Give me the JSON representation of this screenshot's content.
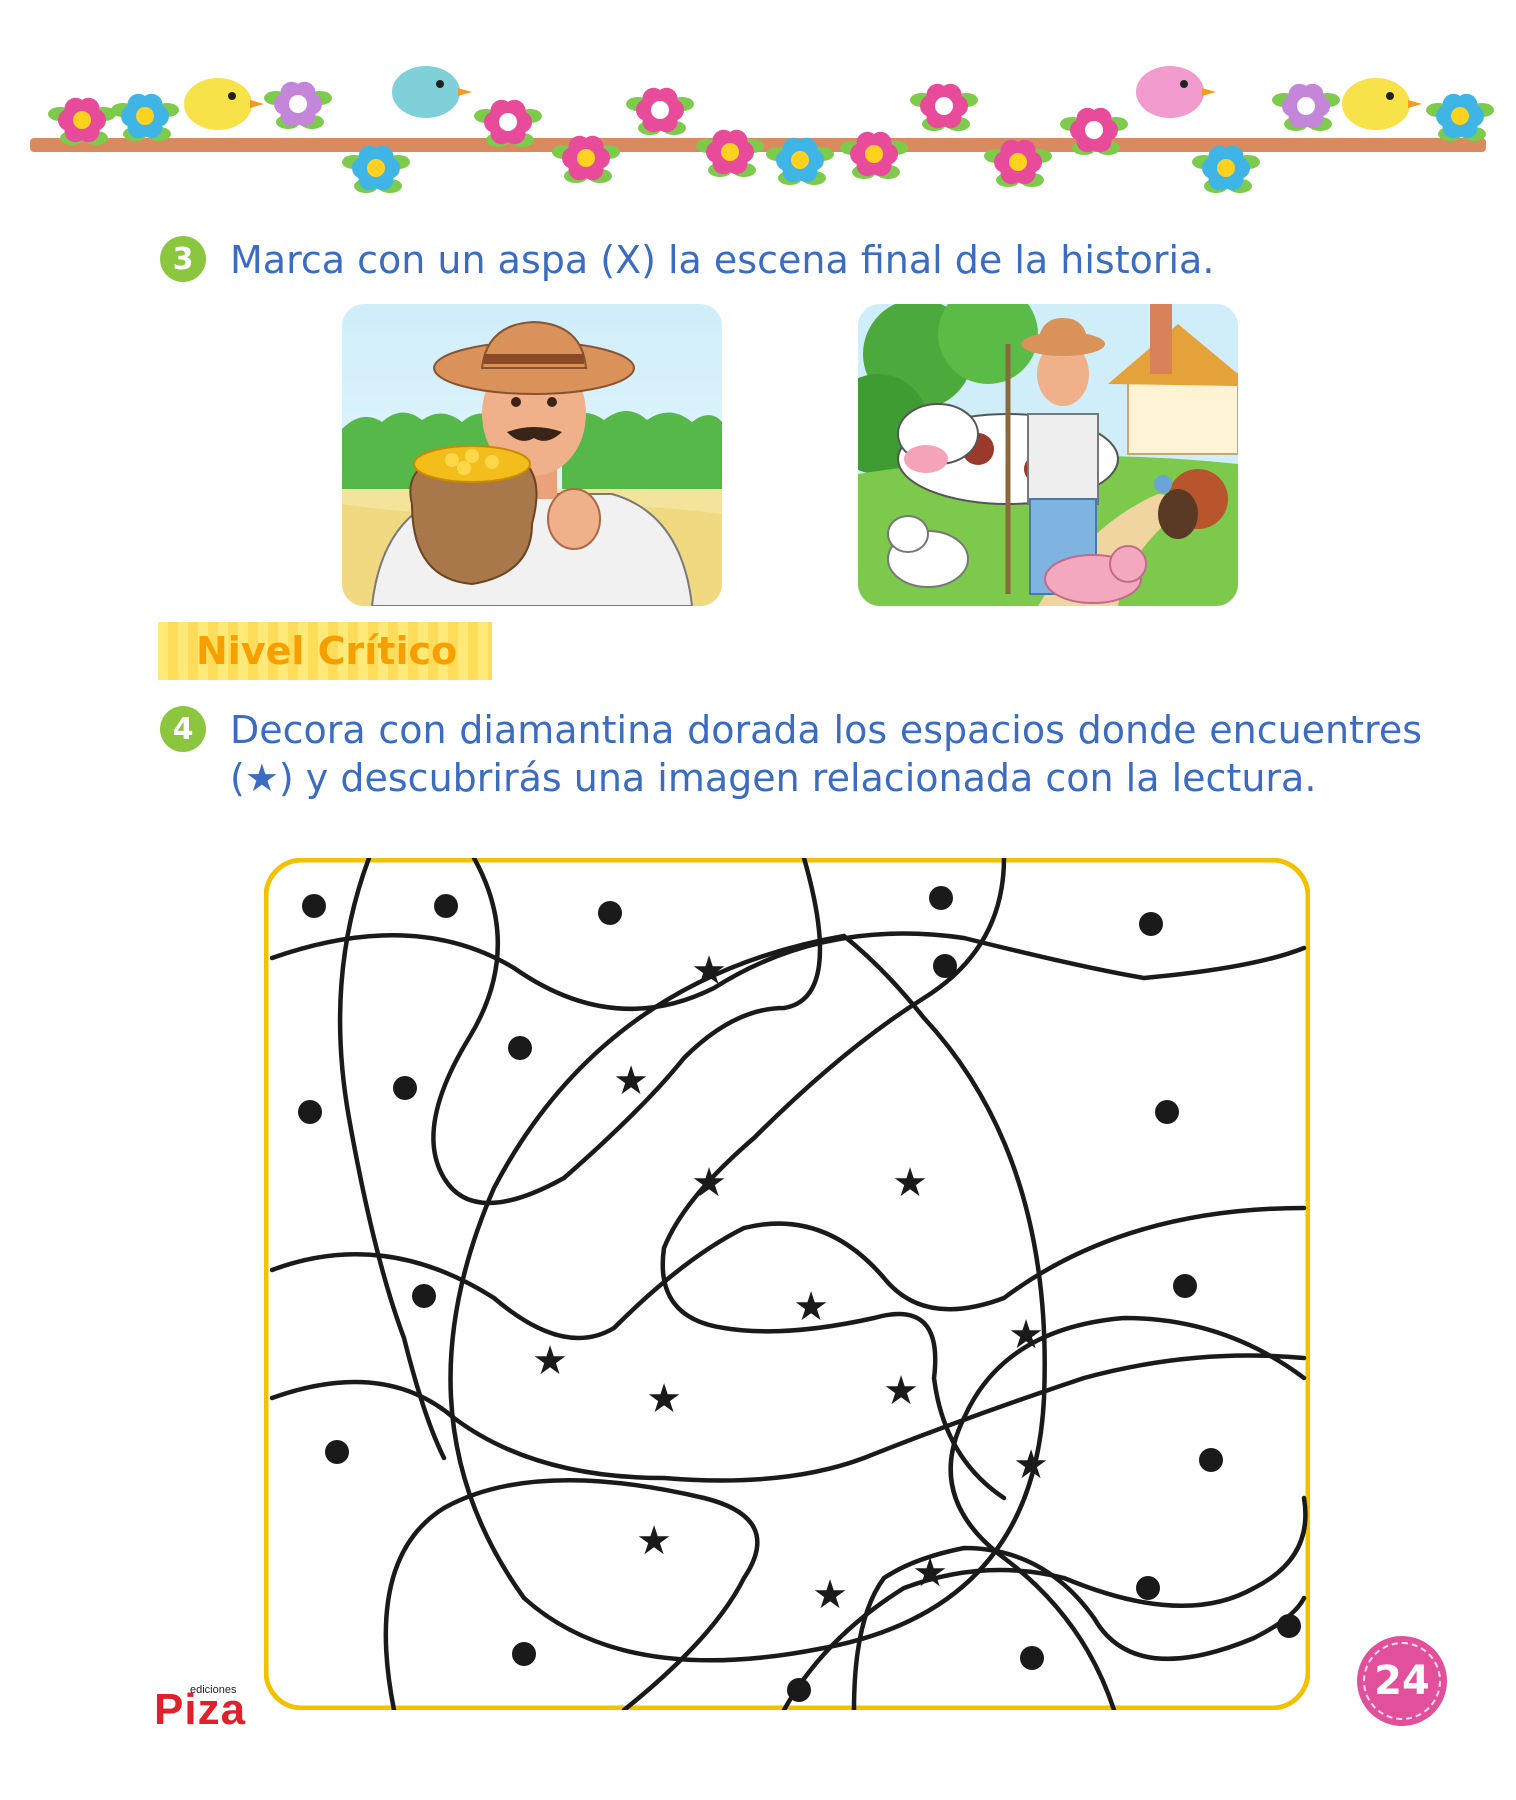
{
  "question3": {
    "number": "3",
    "text": "Marca con un aspa (X) la escena final de la historia."
  },
  "level": {
    "label": "Nivel Crítico"
  },
  "question4": {
    "number": "4",
    "text_before": "Decora con diamantina dorada los espacios donde encuentres (",
    "star_glyph": "★",
    "text_after": ") y descubrirás una imagen relacionada con la lectura."
  },
  "page_number": "24",
  "logo": {
    "small": "ediciones",
    "main": "Piza"
  },
  "colors": {
    "question_text": "#3b6cc0",
    "number_circle": "#8cc63f",
    "level_text": "#f5a000",
    "maze_border": "#f2c200",
    "page_badge": "#e2509b",
    "logo": "#e0212b"
  }
}
